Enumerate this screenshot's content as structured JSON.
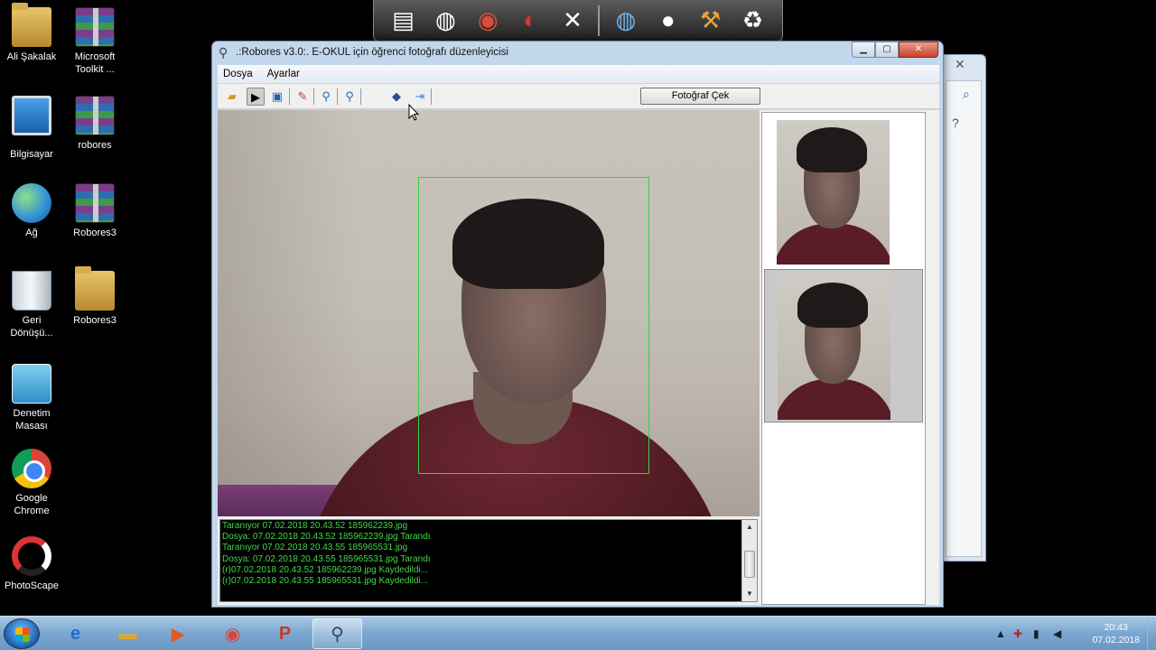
{
  "desktop": {
    "icons": [
      {
        "label": "Ali Şakalak",
        "icon": "user-folder-icon"
      },
      {
        "label": "Microsoft Toolkit ...",
        "icon": "winrar-archive-icon"
      },
      {
        "label": "Bilgisayar",
        "icon": "computer-icon"
      },
      {
        "label": "robores",
        "icon": "winrar-archive-icon"
      },
      {
        "label": "Ağ",
        "icon": "network-globe-icon"
      },
      {
        "label": "Robores3",
        "icon": "winrar-archive-icon"
      },
      {
        "label": "Geri Dönüşü...",
        "icon": "recycle-bin-icon"
      },
      {
        "label": "Robores3",
        "icon": "folder-icon"
      },
      {
        "label": "Denetim Masası",
        "icon": "control-panel-icon"
      },
      {
        "label": "Google Chrome",
        "icon": "chrome-icon"
      },
      {
        "label": "PhotoScape",
        "icon": "photoscape-icon"
      }
    ]
  },
  "window": {
    "title": ".:Robores v3.0:.  E-OKUL için öğrenci fotoğrafı düzenleyicisi",
    "menu": [
      "Dosya",
      "Ayarlar"
    ],
    "capture_button": "Fotoğraf Çek"
  },
  "log": {
    "lines": [
      "Taranıyor 07.02.2018 20.43.52 185962239.jpg",
      "Dosya: 07.02.2018 20.43.52 185962239.jpg Tarandı",
      "Taranıyor 07.02.2018 20.43.55 185965531.jpg",
      "Dosya: 07.02.2018 20.43.55 185965531.jpg Tarandı",
      "(r)07.02.2018 20.43.52 185962239.jpg Kaydedildi...",
      "(r)07.02.2018 20.43.55 185965531.jpg Kaydedildi..."
    ]
  },
  "colors": {
    "log_text": "#44d84a",
    "face_box": "#39d23a",
    "taskbar": "#7aa6cf"
  },
  "taskbar": {
    "clock_time": "20:43",
    "clock_date": "07.02.2018"
  }
}
